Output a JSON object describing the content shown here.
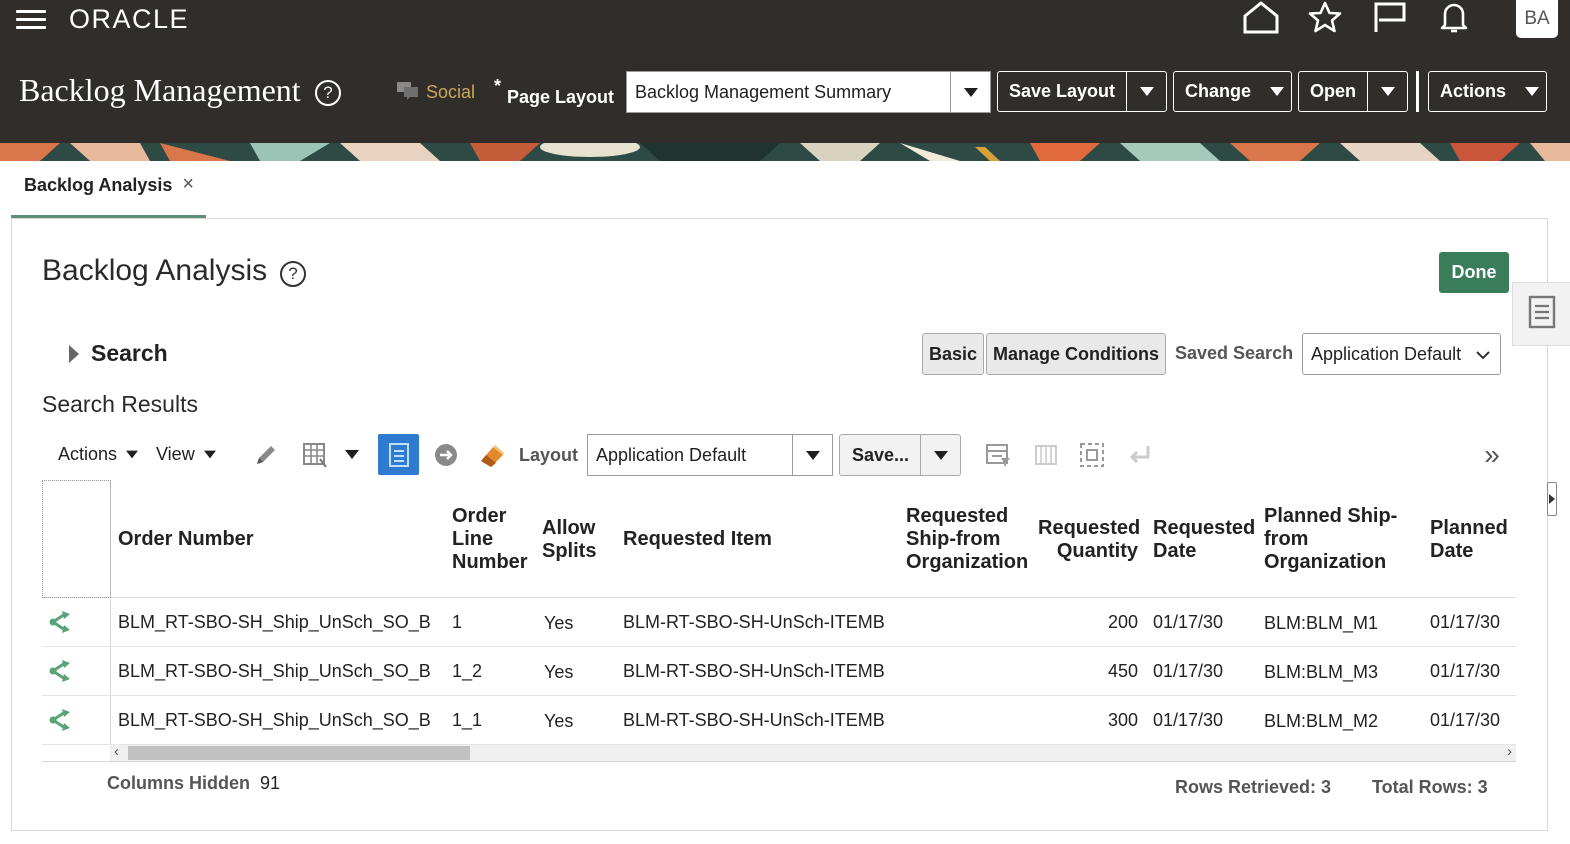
{
  "header": {
    "logo": "ORACLE",
    "avatar_initials": "BA",
    "page_title": "Backlog Management",
    "help_glyph": "?",
    "social_label": "Social",
    "page_layout_asterisk": "*",
    "page_layout_label": "Page Layout",
    "page_layout_value": "Backlog Management Summary",
    "buttons": {
      "save_layout": "Save Layout",
      "change": "Change",
      "open": "Open",
      "actions": "Actions"
    },
    "icons": [
      "home-icon",
      "favorites-star-icon",
      "flag-icon",
      "notifications-bell-icon"
    ]
  },
  "tab": {
    "label": "Backlog Analysis",
    "close_glyph": "×"
  },
  "panel": {
    "title": "Backlog Analysis",
    "done_label": "Done",
    "search_label": "Search",
    "basic_label": "Basic",
    "manage_conditions_label": "Manage Conditions",
    "saved_search_label": "Saved Search",
    "saved_search_value": "Application Default",
    "results_title": "Search Results"
  },
  "toolbar": {
    "actions_label": "Actions",
    "view_label": "View",
    "layout_label": "Layout",
    "layout_value": "Application Default",
    "save_label": "Save...",
    "more_glyph": "»"
  },
  "table": {
    "columns": [
      "Order Number",
      "Order Line Number",
      "Allow Splits",
      "Requested Item",
      "Requested Ship-from Organization",
      "Requested Quantity",
      "Requested Date",
      "Planned Ship-from Organization",
      "Planned Date"
    ],
    "rows": [
      [
        "BLM_RT-SBO-SH_Ship_UnSch_SO_B",
        "1",
        "Yes",
        "BLM-RT-SBO-SH-UnSch-ITEMB",
        "",
        "200",
        "01/17/30",
        "BLM:BLM_M1",
        "01/17/30"
      ],
      [
        "BLM_RT-SBO-SH_Ship_UnSch_SO_B",
        "1_2",
        "Yes",
        "BLM-RT-SBO-SH-UnSch-ITEMB",
        "",
        "450",
        "01/17/30",
        "BLM:BLM_M3",
        "01/17/30"
      ],
      [
        "BLM_RT-SBO-SH_Ship_UnSch_SO_B",
        "1_1",
        "Yes",
        "BLM-RT-SBO-SH-UnSch-ITEMB",
        "",
        "300",
        "01/17/30",
        "BLM:BLM_M2",
        "01/17/30"
      ]
    ]
  },
  "footer": {
    "columns_hidden_label": "Columns Hidden",
    "columns_hidden_value": "91",
    "rows_retrieved_label": "Rows Retrieved: 3",
    "total_rows_label": "Total Rows: 3"
  },
  "colors": {
    "header_bg": "#312d2a",
    "done_green": "#3a7d5b",
    "tab_underline": "#5b8f78",
    "social_gold": "#c9a85c",
    "active_icon_blue": "#2f7bd1",
    "row_icon_green": "#5aa37a"
  }
}
